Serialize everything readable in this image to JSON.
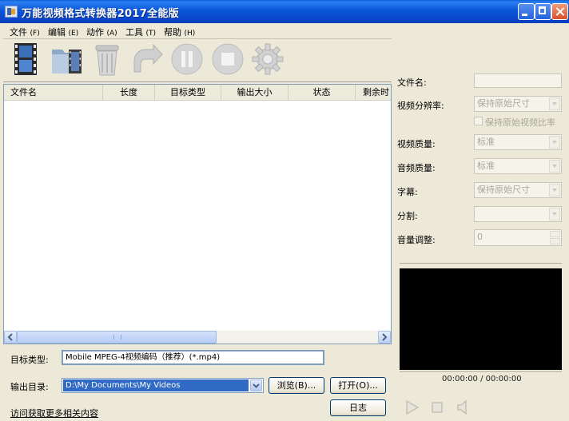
{
  "window": {
    "title": "万能视频格式转换器2017全能版"
  },
  "menu": [
    {
      "label": "文件",
      "key": "(F)"
    },
    {
      "label": "编辑",
      "key": "(E)"
    },
    {
      "label": "动作",
      "key": "(A)"
    },
    {
      "label": "工具",
      "key": "(T)"
    },
    {
      "label": "帮助",
      "key": "(H)"
    }
  ],
  "toolbar": {
    "icons": [
      "film-add-icon",
      "folder-add-icon",
      "trash-icon",
      "redo-icon",
      "pause-icon",
      "stop-icon",
      "gear-icon"
    ]
  },
  "file_list": {
    "columns": [
      "文件名",
      "长度",
      "目标类型",
      "输出大小",
      "状态",
      "剩余时"
    ]
  },
  "bottom": {
    "target_type_label": "目标类型:",
    "target_type_value": "Mobile MPEG-4视频编码（推荐）(*.mp4)",
    "output_dir_label": "输出目录:",
    "output_dir_value": "D:\\My Documents\\My Videos",
    "browse_label": "浏览(B)...",
    "open_label": "打开(O)...",
    "log_label": "日志",
    "more_link": "访问获取更多相关内容"
  },
  "settings": {
    "filename_label": "文件名:",
    "resolution_label": "视频分辨率:",
    "resolution_value": "保持原始尺寸",
    "keep_ratio_label": "保持原始视频比率",
    "video_quality_label": "视频质量:",
    "video_quality_value": "标准",
    "audio_quality_label": "音频质量:",
    "audio_quality_value": "标准",
    "subtitle_label": "字幕:",
    "subtitle_value": "保持原始尺寸",
    "split_label": "分割:",
    "volume_label": "音量调整:",
    "volume_value": "0"
  },
  "player": {
    "time": "00:00:00 / 00:00:00"
  },
  "colors": {
    "title_bar": "#0a50d6",
    "window_bg": "#ece9d8",
    "selection": "#316ac5"
  }
}
